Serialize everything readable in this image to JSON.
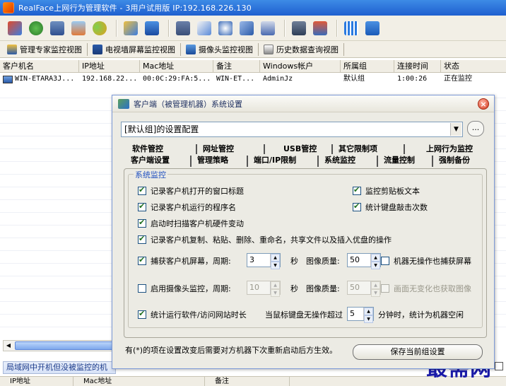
{
  "window": {
    "title": "RealFace上网行为管理软件 - 3用户试用版 IP:192.168.226.130"
  },
  "toolbar": {
    "icons": [
      "install-icon",
      "network-icon",
      "monitor-icon",
      "clear-icon",
      "users-icon",
      "chart-icon",
      "upload-icon",
      "screen-icon",
      "email-icon",
      "search-icon",
      "transfer-icon",
      "remote-icon",
      "list-icon",
      "settings-icon",
      "bars-icon",
      "help-icon"
    ]
  },
  "view_tabs": [
    {
      "label": "管理专家监控视图",
      "icon": "expert-view-icon"
    },
    {
      "label": "电视墙屏幕监控视图",
      "icon": "tv-wall-icon"
    },
    {
      "label": "摄像头监控视图",
      "icon": "camera-icon"
    },
    {
      "label": "历史数据查询视图",
      "icon": "history-icon"
    }
  ],
  "client_list": {
    "columns": [
      "客户机名",
      "IP地址",
      "Mac地址",
      "备注",
      "Windows帐户",
      "所属组",
      "连接时间",
      "状态"
    ],
    "rows": [
      [
        "WIN-ETARA3J...",
        "192.168.22...",
        "00:0C:29:FA:5...",
        "WIN-ET...",
        "AdminJz",
        "默认组",
        "1:00:26",
        "正在监控"
      ]
    ]
  },
  "bottom_panel": {
    "title": "局域网中开机但没被监控的机",
    "columns": [
      "IP地址",
      "Mac地址",
      "备注"
    ]
  },
  "watermark": "最需网",
  "dialog": {
    "title": "客户端（被管理机器）系统设置",
    "group_select": "[默认组]的设置配置",
    "more_button": "...",
    "tabs_row1": [
      "软件管控",
      "网址管控",
      "USB管控",
      "其它限制项",
      "上网行为监控"
    ],
    "tabs_row2": [
      "客户端设置",
      "管理策略",
      "端口/IP限制",
      "系统监控",
      "流量控制",
      "强制备份"
    ],
    "active_tab": "系统监控",
    "section_title": "系统监控",
    "options": {
      "record_window_title": {
        "label": "记录客户机打开的窗口标题",
        "checked": true
      },
      "monitor_clipboard": {
        "label": "监控剪贴板文本",
        "checked": true
      },
      "record_program_name": {
        "label": "记录客户机运行的程序名",
        "checked": true
      },
      "count_keystrokes": {
        "label": "统计键盘敲击次数",
        "checked": true
      },
      "scan_hardware_change": {
        "label": "启动时扫描客户机硬件变动",
        "checked": true
      },
      "record_file_ops": {
        "label": "记录客户机复制、粘贴、删除、重命名，共享文件以及插入优盘的操作",
        "checked": true
      }
    },
    "screen_capture": {
      "label": "捕获客户机屏幕，周期:",
      "checked": true,
      "period": "3",
      "unit": "秒",
      "quality_label": "图像质量:",
      "quality": "50",
      "idle_label": "机器无操作也捕获屏幕",
      "idle_checked": false
    },
    "camera_monitor": {
      "label": "启用摄像头监控，周期:",
      "checked": false,
      "period": "10",
      "unit": "秒",
      "quality_label": "图像质量:",
      "quality": "50",
      "nochange_label": "画面无变化也获取图像",
      "nochange_checked": false
    },
    "usage_stats": {
      "label": "统计运行软件/访问网站时长",
      "checked": true,
      "idle_prefix": "当鼠标键盘无操作超过",
      "idle_minutes": "5",
      "idle_suffix": "分钟时，统计为机器空闲"
    },
    "footnote": "有(*)的项在设置改变后需要对方机器下次重新启动后方生效。",
    "save_button": "保存当前组设置"
  }
}
